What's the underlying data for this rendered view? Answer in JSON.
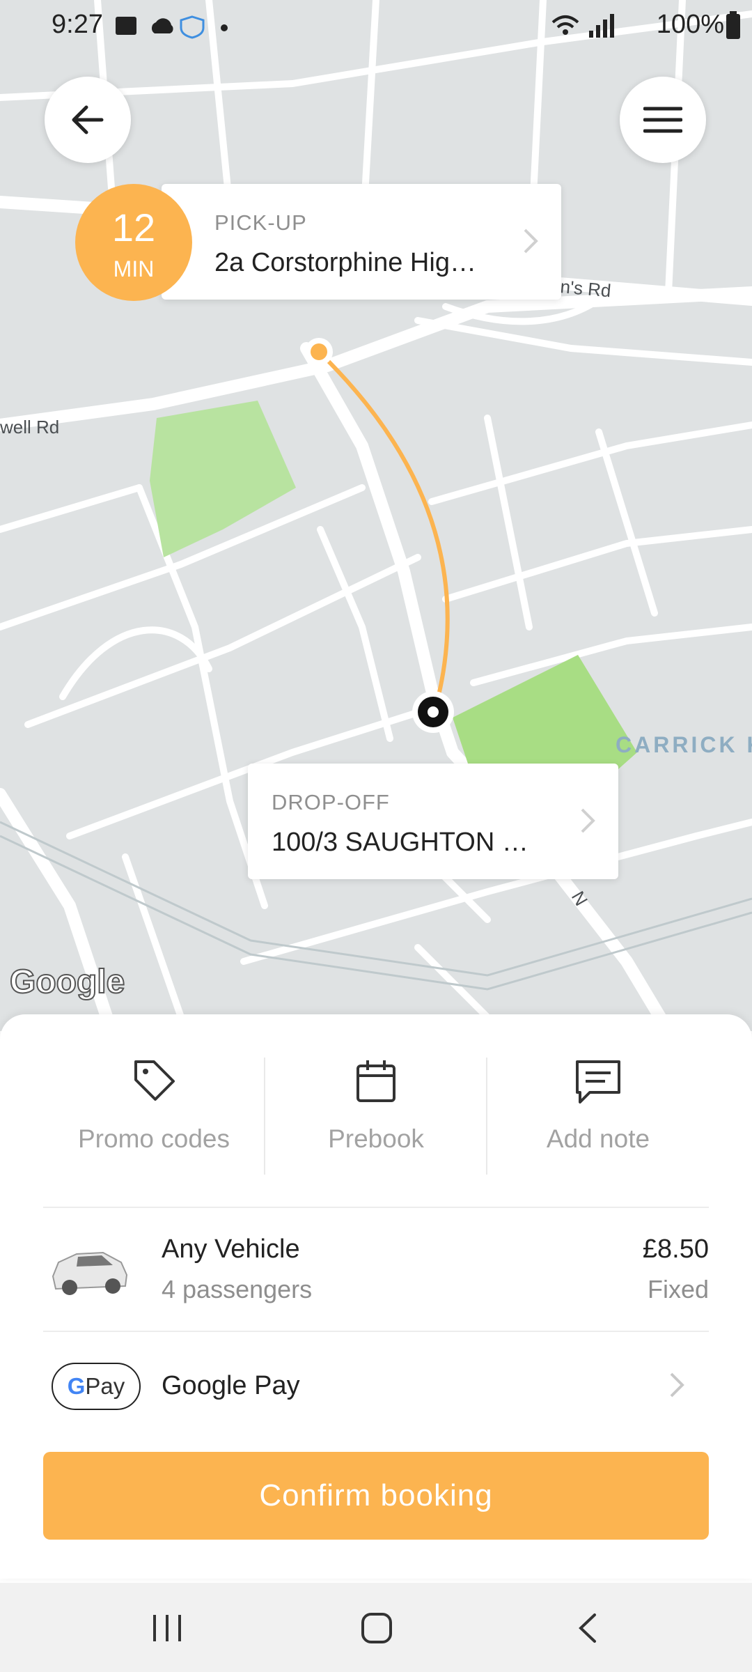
{
  "status_bar": {
    "time": "9:27",
    "battery": "100%"
  },
  "map": {
    "road_labels": [
      "well Rd",
      "n's Rd",
      "CARRICK K",
      "N"
    ],
    "google_logo": "Google"
  },
  "eta": {
    "value": "12",
    "unit": "MIN"
  },
  "pickup": {
    "label": "PICK-UP",
    "address": "2a Corstorphine Hig…"
  },
  "dropoff": {
    "label": "DROP-OFF",
    "address": "100/3 SAUGHTON …"
  },
  "actions": [
    {
      "label": "Promo codes",
      "icon": "tag-icon"
    },
    {
      "label": "Prebook",
      "icon": "calendar-icon"
    },
    {
      "label": "Add note",
      "icon": "message-icon"
    }
  ],
  "vehicle": {
    "name": "Any Vehicle",
    "passengers": "4 passengers",
    "price": "£8.50",
    "price_type": "Fixed"
  },
  "payment": {
    "badge": "Pay",
    "badge_g": "G",
    "method": "Google Pay"
  },
  "confirm_label": "Confirm booking",
  "colors": {
    "accent": "#fcb450",
    "park": "#a8dd84",
    "map_bg": "#dfe2e3"
  }
}
